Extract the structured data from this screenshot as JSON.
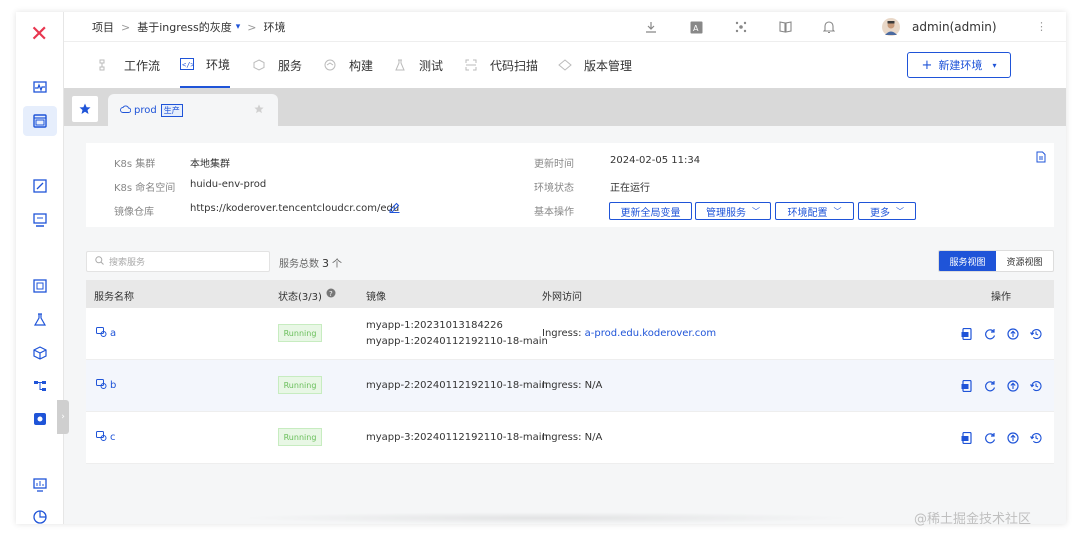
{
  "app": {
    "logo": "✕"
  },
  "breadcrumb": {
    "root": "项目",
    "sep1": ">",
    "project": "基于ingress的灰度",
    "project_caret": "▾",
    "sep2": ">",
    "current": "环境"
  },
  "topbar": {
    "username": "admin(admin)",
    "kebab": "⋮"
  },
  "nav": {
    "tabs": [
      {
        "label": "工作流",
        "icon": "workflow-icon"
      },
      {
        "label": "环境",
        "icon": "environment-icon",
        "active": true
      },
      {
        "label": "服务",
        "icon": "service-icon"
      },
      {
        "label": "构建",
        "icon": "build-icon"
      },
      {
        "label": "测试",
        "icon": "test-icon"
      },
      {
        "label": "代码扫描",
        "icon": "code-scan-icon"
      },
      {
        "label": "版本管理",
        "icon": "version-icon"
      }
    ],
    "new_env_plus": "+",
    "new_env": "新建环境",
    "new_env_caret": "▾"
  },
  "env_tab": {
    "name": "prod",
    "tag": "生产"
  },
  "info": {
    "k8s_cluster_label": "K8s 集群",
    "k8s_cluster_value": "本地集群",
    "namespace_label": "K8s 命名空间",
    "namespace_value": "huidu-env-prod",
    "registry_label": "镜像仓库",
    "registry_value": "https://koderover.tencentcloudcr.com/edu",
    "updated_label": "更新时间",
    "updated_value": "2024-02-05 11:34",
    "status_label": "环境状态",
    "status_value": "正在运行",
    "ops_label": "基本操作",
    "ops": {
      "update_vars": "更新全局变量",
      "manage_services": "管理服务",
      "env_config": "环境配置",
      "more": "更多"
    }
  },
  "list": {
    "search_placeholder": "搜索服务",
    "count_label": "服务总数",
    "count_value": "3",
    "count_unit": "个",
    "view_service": "服务视图",
    "view_resource": "资源视图"
  },
  "table": {
    "headers": {
      "name": "服务名称",
      "status": "状态(3/3)",
      "image": "镜像",
      "access": "外网访问",
      "actions": "操作"
    },
    "rows": [
      {
        "name": "a",
        "status": "Running",
        "images": [
          "myapp-1:20231013184226",
          "myapp-1:20240112192110-18-main"
        ],
        "ingress_label": "Ingress:",
        "ingress_value": "a-prod.edu.koderover.com",
        "ingress_link": true
      },
      {
        "name": "b",
        "status": "Running",
        "images": [
          "myapp-2:20240112192110-18-main"
        ],
        "ingress_label": "Ingress:",
        "ingress_value": "N/A",
        "ingress_link": false
      },
      {
        "name": "c",
        "status": "Running",
        "images": [
          "myapp-3:20240112192110-18-main"
        ],
        "ingress_label": "Ingress:",
        "ingress_value": "N/A",
        "ingress_link": false
      }
    ]
  },
  "watermark": "@稀土掘金技术社区",
  "colors": {
    "accent": "#1f54d8",
    "logo": "#e8364f",
    "running_bg": "#e8f7e5",
    "running_text": "#6abf5b"
  }
}
